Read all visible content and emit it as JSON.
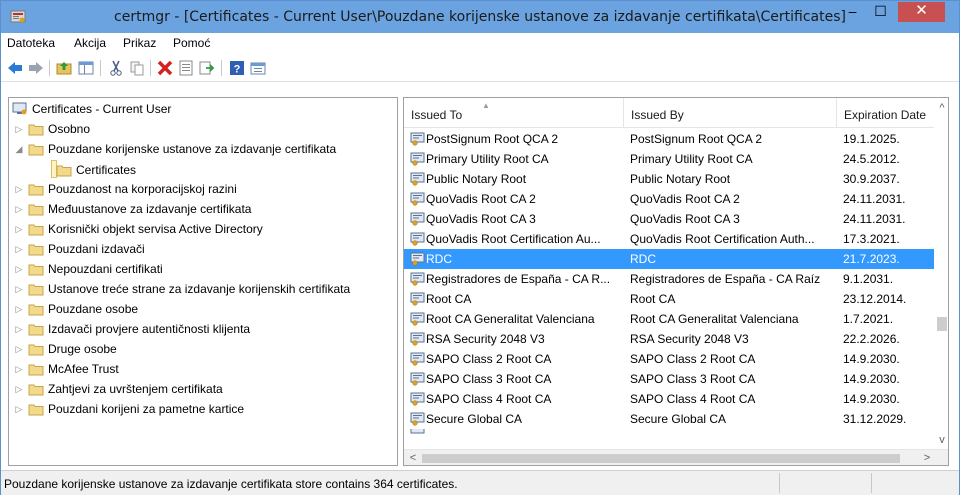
{
  "window": {
    "title": "certmgr - [Certificates - Current User\\Pouzdane korijenske ustanove za izdavanje certifikata\\Certificates]",
    "minimize": "–",
    "maximize": "☐",
    "close": "✕"
  },
  "menu": [
    {
      "label": "Datoteka"
    },
    {
      "label": "Akcija"
    },
    {
      "label": "Prikaz"
    },
    {
      "label": "Pomoć"
    }
  ],
  "toolbar": {
    "icons": [
      "back-icon",
      "forward-icon",
      "up-folder-icon",
      "show-hide-tree-icon",
      "cut-icon",
      "copy-icon",
      "delete-icon",
      "properties-icon",
      "export-icon",
      "help-icon",
      "view-icon"
    ]
  },
  "tree": {
    "root": "Certificates - Current User",
    "items": [
      {
        "label": "Osobno",
        "level": 1,
        "expanded": false
      },
      {
        "label": "Pouzdane korijenske ustanove za izdavanje certifikata",
        "level": 1,
        "expanded": true
      },
      {
        "label": "Certificates",
        "level": 2,
        "selected": true
      },
      {
        "label": "Pouzdanost na korporacijskoj razini",
        "level": 1,
        "expanded": false
      },
      {
        "label": "Međuustanove za izdavanje certifikata",
        "level": 1,
        "expanded": false
      },
      {
        "label": "Korisnički objekt servisa Active Directory",
        "level": 1,
        "expanded": false
      },
      {
        "label": "Pouzdani izdavači",
        "level": 1,
        "expanded": false
      },
      {
        "label": "Nepouzdani certifikati",
        "level": 1,
        "expanded": false
      },
      {
        "label": "Ustanove treće strane za izdavanje korijenskih certifikata",
        "level": 1,
        "expanded": false
      },
      {
        "label": "Pouzdane osobe",
        "level": 1,
        "expanded": false
      },
      {
        "label": "Izdavači provjere autentičnosti klijenta",
        "level": 1,
        "expanded": false
      },
      {
        "label": "Druge osobe",
        "level": 1,
        "expanded": false
      },
      {
        "label": "McAfee Trust",
        "level": 1,
        "expanded": false
      },
      {
        "label": "Zahtjevi za uvrštenjem certifikata",
        "level": 1,
        "expanded": false
      },
      {
        "label": "Pouzdani korijeni za pametne kartice",
        "level": 1,
        "expanded": false
      }
    ]
  },
  "list": {
    "columns": [
      "Issued To",
      "Issued By",
      "Expiration Date"
    ],
    "rows": [
      {
        "to": "PostSignum Root QCA 2",
        "by": "PostSignum Root QCA 2",
        "exp": "19.1.2025."
      },
      {
        "to": "Primary Utility Root CA",
        "by": "Primary Utility Root CA",
        "exp": "24.5.2012."
      },
      {
        "to": "Public Notary Root",
        "by": "Public Notary Root",
        "exp": "30.9.2037."
      },
      {
        "to": "QuoVadis Root CA 2",
        "by": "QuoVadis Root CA 2",
        "exp": "24.11.2031."
      },
      {
        "to": "QuoVadis Root CA 3",
        "by": "QuoVadis Root CA 3",
        "exp": "24.11.2031."
      },
      {
        "to": "QuoVadis Root Certification Au...",
        "by": "QuoVadis Root Certification Auth...",
        "exp": "17.3.2021."
      },
      {
        "to": "RDC",
        "by": "RDC",
        "exp": "21.7.2023.",
        "selected": true
      },
      {
        "to": "Registradores de España - CA R...",
        "by": "Registradores de España - CA Raíz",
        "exp": "9.1.2031."
      },
      {
        "to": "Root CA",
        "by": "Root CA",
        "exp": "23.12.2014."
      },
      {
        "to": "Root CA Generalitat Valenciana",
        "by": "Root CA Generalitat Valenciana",
        "exp": "1.7.2021."
      },
      {
        "to": "RSA Security 2048 V3",
        "by": "RSA Security 2048 V3",
        "exp": "22.2.2026."
      },
      {
        "to": "SAPO Class 2 Root CA",
        "by": "SAPO Class 2 Root CA",
        "exp": "14.9.2030."
      },
      {
        "to": "SAPO Class 3 Root CA",
        "by": "SAPO Class 3 Root CA",
        "exp": "14.9.2030."
      },
      {
        "to": "SAPO Class 4 Root CA",
        "by": "SAPO Class 4 Root CA",
        "exp": "14.9.2030."
      },
      {
        "to": "Secure Global CA",
        "by": "Secure Global CA",
        "exp": "31.12.2029."
      }
    ]
  },
  "status": {
    "text": "Pouzdane korijenske ustanove za izdavanje certifikata store contains 364 certificates."
  },
  "colors": {
    "titlebar": "#6aa3e0",
    "selection": "#3399ff",
    "close": "#c75050"
  }
}
